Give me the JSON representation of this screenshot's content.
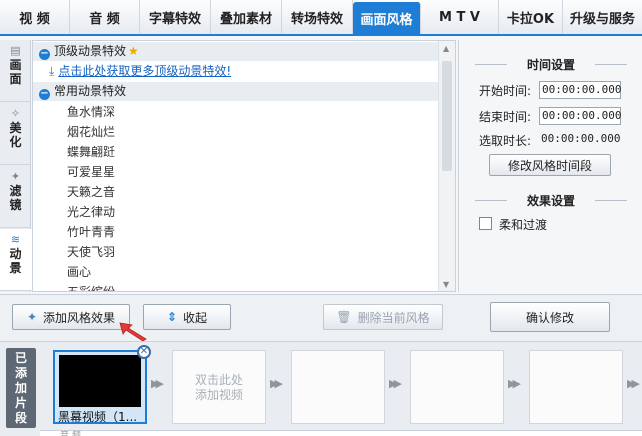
{
  "tabs": [
    {
      "label": "视 频",
      "active": false
    },
    {
      "label": "音 频",
      "active": false
    },
    {
      "label": "字幕特效",
      "active": false
    },
    {
      "label": "叠加素材",
      "active": false
    },
    {
      "label": "转场特效",
      "active": false
    },
    {
      "label": "画面风格",
      "active": true
    },
    {
      "label": "M T V",
      "active": false
    },
    {
      "label": "卡拉OK",
      "active": false
    },
    {
      "label": "升级与服务",
      "active": false
    }
  ],
  "side_tabs": [
    {
      "label": "画面",
      "icon": "picture-icon"
    },
    {
      "label": "美化",
      "icon": "magic-wand-icon"
    },
    {
      "label": "滤镜",
      "icon": "filter-wand-icon"
    },
    {
      "label": "动景",
      "icon": "wave-icon"
    }
  ],
  "list": {
    "premium_header": "顶级动景特效",
    "premium_link": "点击此处获取更多顶级动景特效!",
    "common_header": "常用动景特效",
    "items": [
      "鱼水情深",
      "烟花灿烂",
      "蝶舞翩跹",
      "可爱星星",
      "天籁之音",
      "光之律动",
      "竹叶青青",
      "天使飞羽",
      "画心",
      "五彩缤纷"
    ]
  },
  "settings": {
    "time_title": "时间设置",
    "start_label": "开始时间:",
    "start_value": "00:00:00.000",
    "end_label": "结束时间:",
    "end_value": "00:00:00.000",
    "duration_label": "选取时长:",
    "duration_value": "00:00:00.000",
    "modify_period_button": "修改风格时间段",
    "effect_title": "效果设置",
    "smooth_label": "柔和过渡",
    "confirm_button": "确认修改"
  },
  "actions": {
    "add_button": "添加风格效果",
    "collapse_button": "收起",
    "delete_button": "删除当前风格"
  },
  "clips": {
    "strip_label": "已添加片段",
    "first_caption": "黑幕视频（1...",
    "placeholder": "双击此处\n添加视频",
    "bottom_text": "音 频"
  }
}
